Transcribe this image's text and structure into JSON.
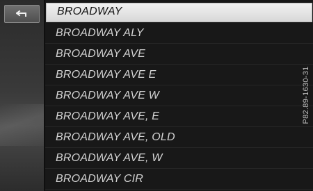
{
  "list": {
    "items": [
      {
        "label": "BROADWAY",
        "selected": true
      },
      {
        "label": "BROADWAY ALY",
        "selected": false
      },
      {
        "label": "BROADWAY AVE",
        "selected": false
      },
      {
        "label": "BROADWAY AVE E",
        "selected": false
      },
      {
        "label": "BROADWAY AVE W",
        "selected": false
      },
      {
        "label": "BROADWAY AVE, E",
        "selected": false
      },
      {
        "label": "BROADWAY AVE, OLD",
        "selected": false
      },
      {
        "label": "BROADWAY AVE, W",
        "selected": false
      },
      {
        "label": "BROADWAY CIR",
        "selected": false
      }
    ]
  },
  "back_button": {
    "icon": "back-arrow-icon"
  },
  "reference_code": "P82.89-1630-31",
  "colors": {
    "background": "#1c1c1c",
    "selected_row": "#e6e6e6",
    "text": "#d4d4d4"
  }
}
